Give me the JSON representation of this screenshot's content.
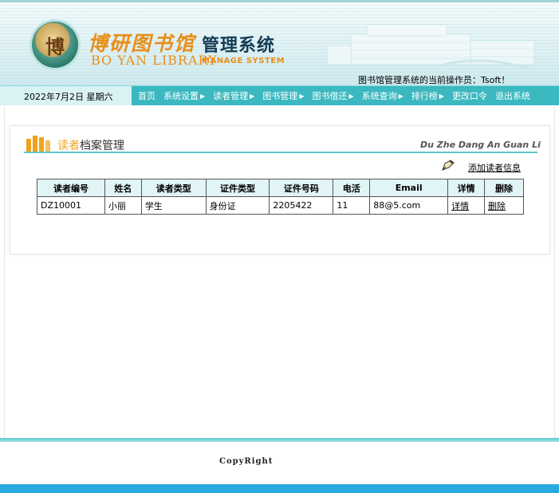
{
  "header": {
    "logo_seal_char": "博",
    "logo_cn": "博研图书馆",
    "logo_suffix": "管理系统",
    "logo_en": "BO YAN LIBRARY",
    "logo_en2": "MANAGE SYSTEM",
    "operator_text": "图书馆管理系统的当前操作员：Tsoft！"
  },
  "nav": {
    "date": "2022年7月2日  星期六",
    "items": [
      {
        "label": "首页",
        "has_arrow": false
      },
      {
        "label": "系统设置",
        "has_arrow": true
      },
      {
        "label": "读者管理",
        "has_arrow": true
      },
      {
        "label": "图书管理",
        "has_arrow": true
      },
      {
        "label": "图书借还",
        "has_arrow": true
      },
      {
        "label": "系统查询",
        "has_arrow": true
      },
      {
        "label": "排行榜",
        "has_arrow": true
      },
      {
        "label": "更改口令",
        "has_arrow": false
      },
      {
        "label": "退出系统",
        "has_arrow": false
      }
    ],
    "arrow_glyph": "▶"
  },
  "section": {
    "title_highlight": "读者",
    "title_rest": "档案管理",
    "pinyin": "Du Zhe Dang An Guan Li",
    "add_label": "添加读者信息"
  },
  "table": {
    "headers": [
      "读者编号",
      "姓名",
      "读者类型",
      "证件类型",
      "证件号码",
      "电活",
      "Email",
      "详情",
      "删除"
    ],
    "rows": [
      [
        "DZ10001",
        "小丽",
        "学生",
        "身份证",
        "2205422",
        "11",
        "88@5.com",
        "详情",
        "删除"
      ]
    ]
  },
  "footer": {
    "copyright": "CopyRight"
  },
  "colors": {
    "accent_teal": "#3bb8c0",
    "accent_orange": "#f0a21a",
    "bottom_blue": "#29a9e0"
  }
}
